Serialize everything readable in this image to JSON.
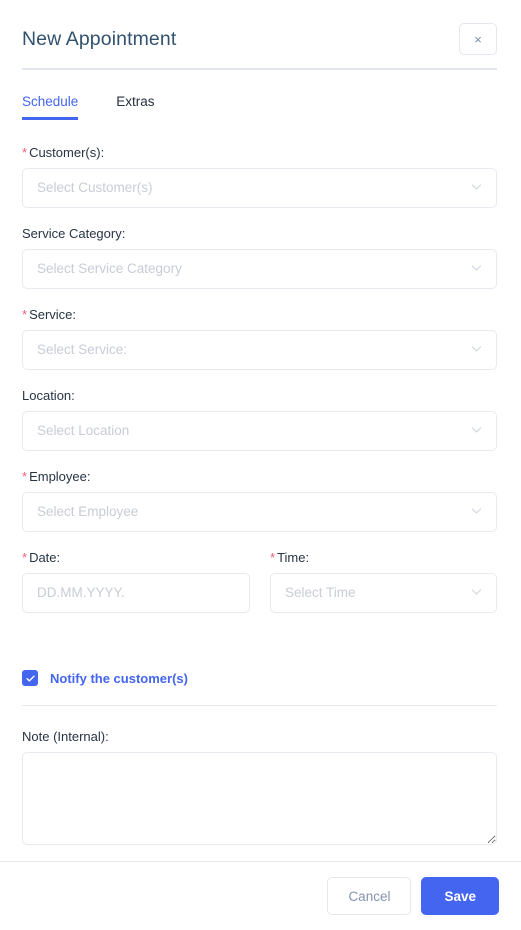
{
  "dialog": {
    "title": "New Appointment",
    "close_label": "×"
  },
  "tabs": [
    {
      "label": "Schedule",
      "active": true
    },
    {
      "label": "Extras",
      "active": false
    }
  ],
  "form": {
    "fields": [
      {
        "label": "Customer(s):",
        "required": true,
        "type": "select",
        "placeholder": "Select Customer(s)",
        "value": ""
      },
      {
        "label": "Service Category:",
        "required": false,
        "type": "select",
        "placeholder": "Select Service Category",
        "value": ""
      },
      {
        "label": "Service:",
        "required": true,
        "type": "select",
        "placeholder": "Select Service:",
        "value": ""
      },
      {
        "label": "Location:",
        "required": false,
        "type": "select",
        "placeholder": "Select Location",
        "value": ""
      },
      {
        "label": "Employee:",
        "required": true,
        "type": "select",
        "placeholder": "Select Employee",
        "value": ""
      }
    ],
    "date": {
      "label": "Date:",
      "required": true,
      "type": "text",
      "placeholder": "DD.MM.YYYY.",
      "value": ""
    },
    "time": {
      "label": "Time:",
      "required": true,
      "type": "select",
      "placeholder": "Select Time",
      "value": ""
    },
    "notify": {
      "label": "Notify the customer(s)",
      "checked": true
    },
    "note": {
      "label": "Note (Internal):",
      "placeholder": "",
      "value": ""
    },
    "required_marker": "*"
  },
  "footer": {
    "cancel_label": "Cancel",
    "save_label": "Save"
  },
  "colors": {
    "accent": "#4365f0",
    "required": "#f3607a",
    "label": "#273444",
    "placeholder": "#c8ccd6",
    "title": "#32526e",
    "border": "#e8eaf0"
  }
}
